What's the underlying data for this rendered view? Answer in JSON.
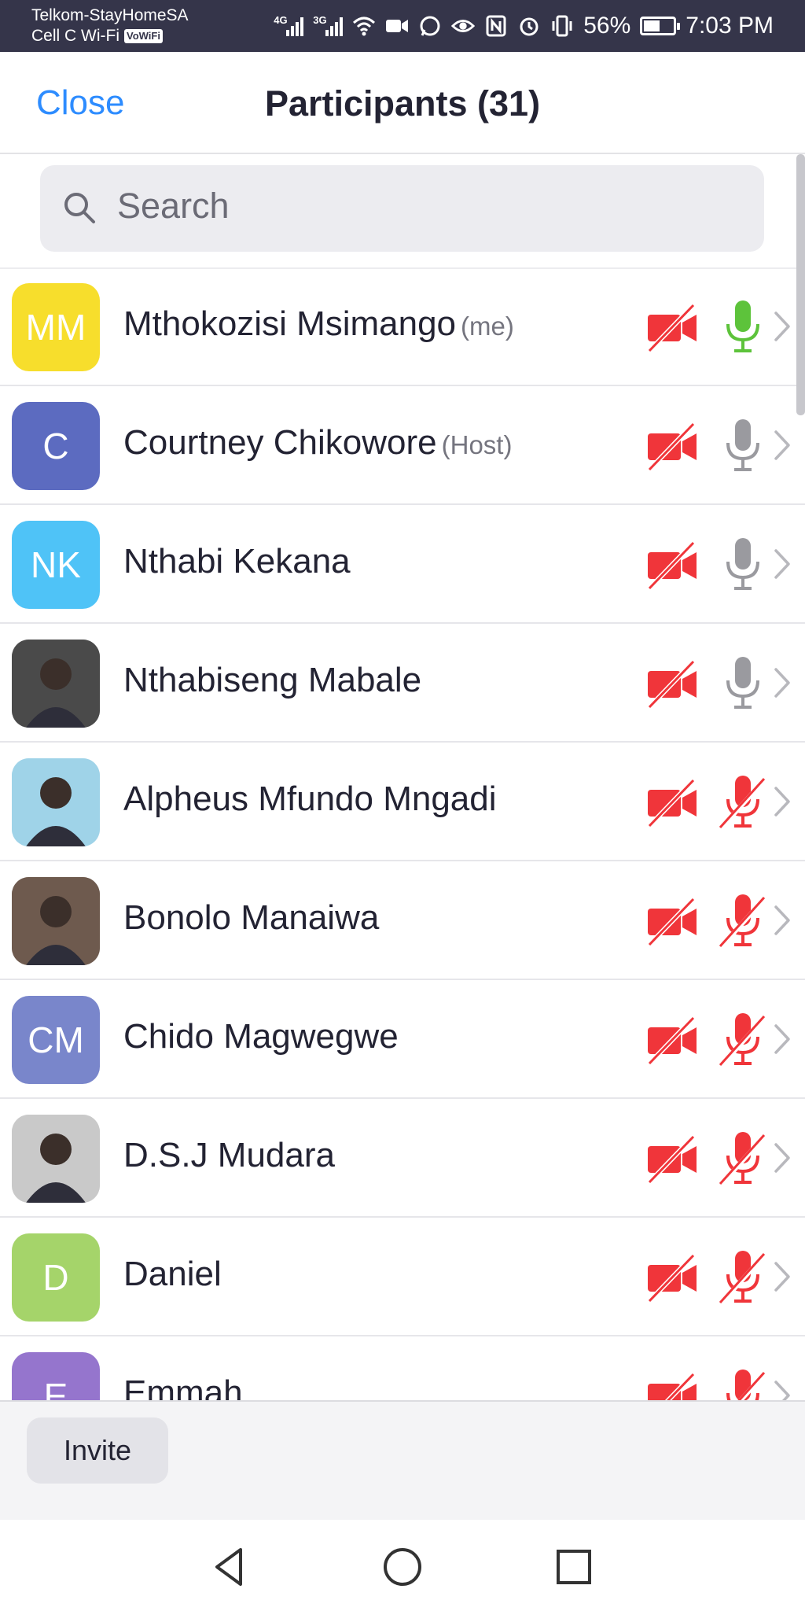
{
  "status_bar": {
    "carrier_line1": "Telkom-StayHomeSA",
    "carrier_line2": "Cell C Wi-Fi",
    "vowifi_badge": "VoWiFi",
    "net_tag_1": "4G",
    "net_tag_2": "3G",
    "battery_percent": "56%",
    "battery_level": 0.56,
    "time": "7:03 PM"
  },
  "header": {
    "close_label": "Close",
    "title": "Participants (31)"
  },
  "search": {
    "placeholder": "Search"
  },
  "participants": [
    {
      "name": "Mthokozisi Msimango",
      "role": "(me)",
      "initials": "MM",
      "avatar_color": "#f7de2c",
      "avatar_type": "initials",
      "mic": "active"
    },
    {
      "name": "Courtney Chikowore",
      "role": "(Host)",
      "initials": "C",
      "avatar_color": "#5c6bc0",
      "avatar_type": "initials",
      "mic": "on"
    },
    {
      "name": "Nthabi Kekana",
      "role": "",
      "initials": "NK",
      "avatar_color": "#4fc3f7",
      "avatar_type": "initials",
      "mic": "on"
    },
    {
      "name": "Nthabiseng Mabale",
      "role": "",
      "initials": "",
      "avatar_color": "#4a4a4a",
      "avatar_type": "photo",
      "mic": "on"
    },
    {
      "name": "Alpheus Mfundo Mngadi",
      "role": "",
      "initials": "",
      "avatar_color": "#9fd3e8",
      "avatar_type": "photo",
      "mic": "muted"
    },
    {
      "name": "Bonolo Manaiwa",
      "role": "",
      "initials": "",
      "avatar_color": "#6e5a4e",
      "avatar_type": "photo",
      "mic": "muted"
    },
    {
      "name": "Chido Magwegwe",
      "role": "",
      "initials": "CM",
      "avatar_color": "#7986cb",
      "avatar_type": "initials",
      "mic": "muted"
    },
    {
      "name": "D.S.J Mudara",
      "role": "",
      "initials": "",
      "avatar_color": "#c9c9c9",
      "avatar_type": "photo",
      "mic": "muted"
    },
    {
      "name": "Daniel",
      "role": "",
      "initials": "D",
      "avatar_color": "#a5d46a",
      "avatar_type": "initials",
      "mic": "muted"
    },
    {
      "name": "Emmah",
      "role": "",
      "initials": "E",
      "avatar_color": "#9575cd",
      "avatar_type": "initials",
      "mic": "muted"
    }
  ],
  "footer": {
    "invite_label": "Invite"
  },
  "colors": {
    "accent": "#2d8cff",
    "muted_red": "#f0353a",
    "mic_active": "#5dc33b",
    "mic_idle": "#9a9a9f"
  },
  "icons": {
    "video": "video-off-icon",
    "mic_on": "microphone-icon",
    "mic_muted": "microphone-muted-icon",
    "chevron": "chevron-right-icon",
    "search": "search-icon"
  }
}
